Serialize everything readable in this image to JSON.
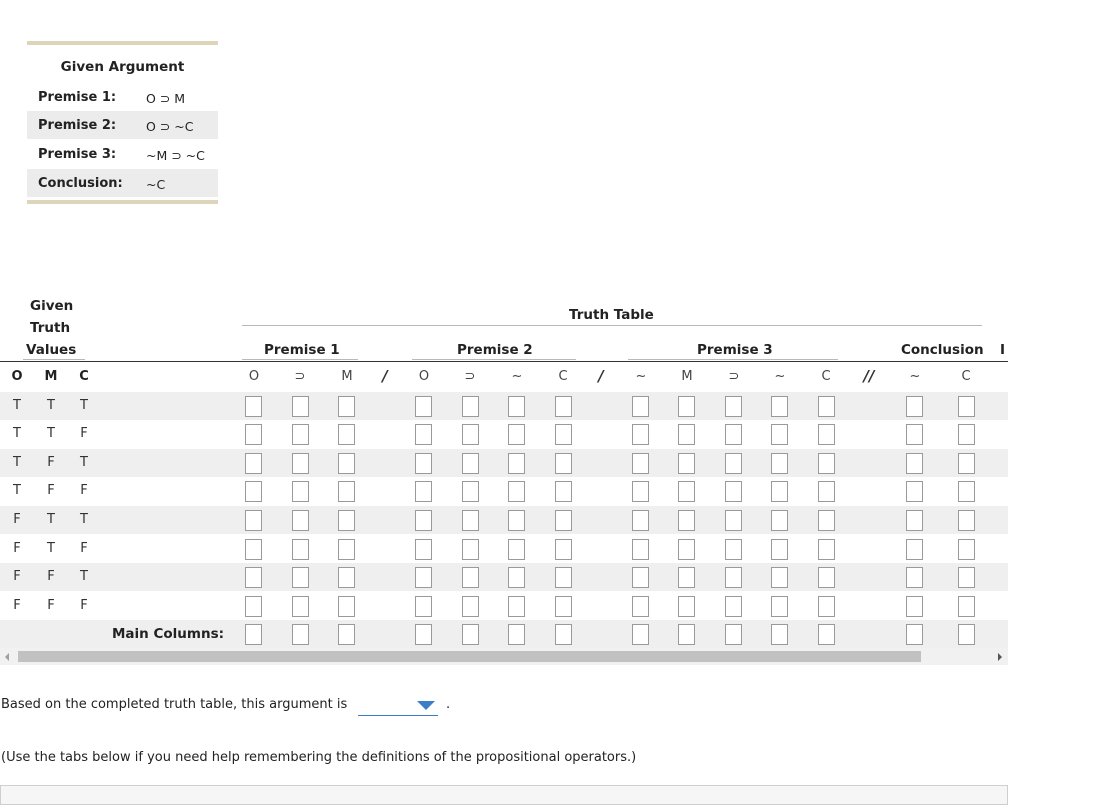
{
  "given_argument": {
    "title": "Given Argument",
    "rows": [
      {
        "label": "Premise 1:",
        "value": "O ⊃ M"
      },
      {
        "label": "Premise 2:",
        "value": "O ⊃ ~C"
      },
      {
        "label": "Premise 3:",
        "value": "~M ⊃ ~C"
      },
      {
        "label": "Conclusion:",
        "value": "~C"
      }
    ]
  },
  "truth_table": {
    "given_header": [
      "Given",
      "Truth",
      "Values"
    ],
    "title": "Truth Table",
    "groups": [
      "Premise 1",
      "Premise 2",
      "Premise 3",
      "Conclusion"
    ],
    "cut_off_group_char": "I",
    "given_vars": [
      "O",
      "M",
      "C"
    ],
    "column_symbols": [
      "O",
      "⊃",
      "M",
      "O",
      "⊃",
      "~",
      "C",
      "~",
      "M",
      "⊃",
      "~",
      "C",
      "~",
      "C"
    ],
    "separators": [
      "/",
      "/",
      "//"
    ],
    "rows": [
      [
        "T",
        "T",
        "T"
      ],
      [
        "T",
        "T",
        "F"
      ],
      [
        "T",
        "F",
        "T"
      ],
      [
        "T",
        "F",
        "F"
      ],
      [
        "F",
        "T",
        "T"
      ],
      [
        "F",
        "T",
        "F"
      ],
      [
        "F",
        "F",
        "T"
      ],
      [
        "F",
        "F",
        "F"
      ]
    ],
    "main_columns_label": "Main Columns:"
  },
  "conclusion": {
    "sentence": "Based on the completed truth table, this argument is",
    "dropdown_value": "",
    "end_punct": "."
  },
  "help_text": "(Use the tabs below if you need help remembering the definitions of the propositional operators.)"
}
